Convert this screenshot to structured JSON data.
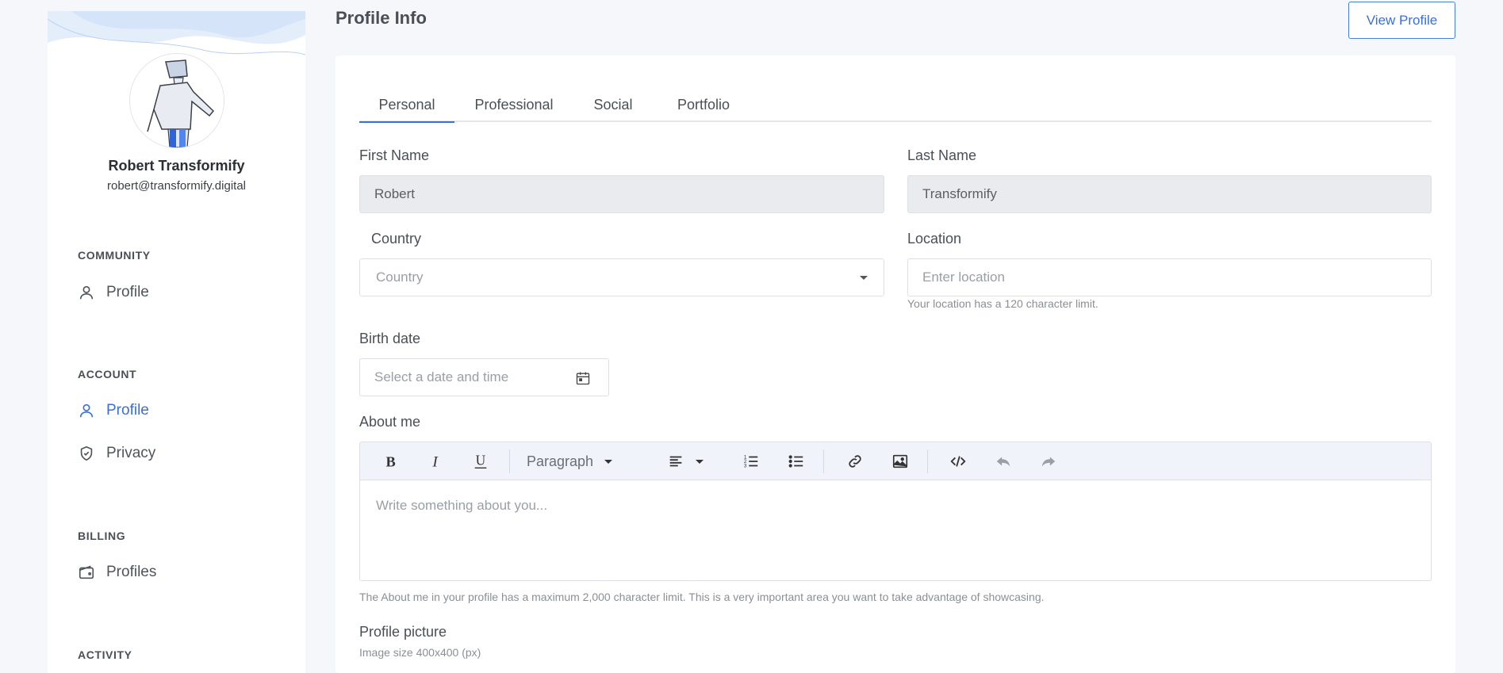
{
  "header": {
    "title": "Profile Info",
    "view_profile_label": "View Profile"
  },
  "sidebar": {
    "user": {
      "name": "Robert Transformify",
      "email": "robert@transformify.digital"
    },
    "sections": {
      "community": "COMMUNITY",
      "account": "ACCOUNT",
      "billing": "BILLING",
      "activity": "ACTIVITY"
    },
    "items": {
      "community_profile": "Profile",
      "account_profile": "Profile",
      "account_privacy": "Privacy",
      "billing_profiles": "Profiles"
    },
    "active_item": "account_profile"
  },
  "tabs": [
    "Personal",
    "Professional",
    "Social",
    "Portfolio"
  ],
  "active_tab": "Personal",
  "form": {
    "first_name": {
      "label": "First Name",
      "value": "Robert"
    },
    "last_name": {
      "label": "Last Name",
      "value": "Transformify"
    },
    "country": {
      "label": "Country",
      "placeholder": "Country"
    },
    "location": {
      "label": "Location",
      "placeholder": "Enter location",
      "hint": "Your location has a 120 character limit."
    },
    "birth_date": {
      "label": "Birth date",
      "placeholder": "Select a date and time"
    },
    "about_me": {
      "label": "About me",
      "placeholder": "Write something about you...",
      "hint": "The About me in your profile has a maximum 2,000 character limit. This is a very important area you want to take advantage of showcasing.",
      "toolbar": {
        "block_format": "Paragraph"
      }
    },
    "profile_picture": {
      "label": "Profile picture",
      "hint": "Image size 400x400 (px)"
    }
  },
  "colors": {
    "accent": "#3a6fd8",
    "disabled_input": "#e9ebee",
    "toolbar_bg": "#f0f3fa"
  }
}
